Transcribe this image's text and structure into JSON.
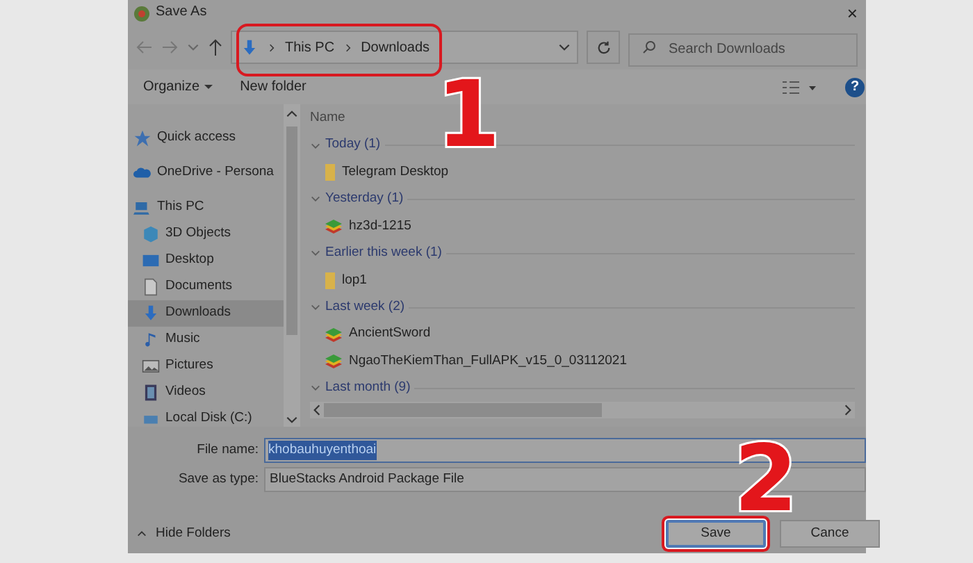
{
  "window": {
    "title": "Save As",
    "close": "×"
  },
  "address": {
    "path": [
      "This PC",
      "Downloads"
    ],
    "highlighted": true,
    "search_placeholder": "Search Downloads"
  },
  "toolbar": {
    "organize": "Organize",
    "new_folder": "New folder",
    "help": "?"
  },
  "sidebar": {
    "items": [
      {
        "label": "Quick access",
        "kind": "star",
        "level_top": true,
        "selected": false
      },
      {
        "label": "OneDrive - Persona",
        "kind": "cloud",
        "level_top": true,
        "selected": false
      },
      {
        "label": "This PC",
        "kind": "pc",
        "level_top": true,
        "selected": false
      },
      {
        "label": "3D Objects",
        "kind": "cube",
        "level_top": false,
        "selected": false
      },
      {
        "label": "Desktop",
        "kind": "desktop",
        "level_top": false,
        "selected": false
      },
      {
        "label": "Documents",
        "kind": "document",
        "level_top": false,
        "selected": false
      },
      {
        "label": "Downloads",
        "kind": "download",
        "level_top": false,
        "selected": true
      },
      {
        "label": "Music",
        "kind": "music",
        "level_top": false,
        "selected": false
      },
      {
        "label": "Pictures",
        "kind": "image",
        "level_top": false,
        "selected": false
      },
      {
        "label": "Videos",
        "kind": "film",
        "level_top": false,
        "selected": false
      },
      {
        "label": "Local Disk (C:)",
        "kind": "disk",
        "level_top": false,
        "selected": false
      }
    ]
  },
  "list": {
    "column": "Name",
    "groups": [
      {
        "label": "Today (1)",
        "items": [
          {
            "name": "Telegram Desktop",
            "kind": "folder"
          }
        ]
      },
      {
        "label": "Yesterday (1)",
        "items": [
          {
            "name": "hz3d-1215",
            "kind": "package"
          }
        ]
      },
      {
        "label": "Earlier this week (1)",
        "items": [
          {
            "name": "lop1",
            "kind": "folder"
          }
        ]
      },
      {
        "label": "Last week (2)",
        "items": [
          {
            "name": "AncientSword",
            "kind": "package"
          },
          {
            "name": "NgaoTheKiemThan_FullAPK_v15_0_03112021",
            "kind": "package"
          }
        ]
      },
      {
        "label": "Last month (9)"
      }
    ]
  },
  "form": {
    "file_name_label": "File name:",
    "file_name": "khobauhuyenthoai",
    "type_label": "Save as type:",
    "type": "BlueStacks Android Package File"
  },
  "footer": {
    "hide_folders": "Hide Folders",
    "buttons": [
      {
        "label": "Save",
        "highlighted": true
      },
      {
        "label": "Cance",
        "highlighted": false
      }
    ]
  },
  "annotations": [
    {
      "number": "1"
    },
    {
      "number": "2"
    }
  ]
}
